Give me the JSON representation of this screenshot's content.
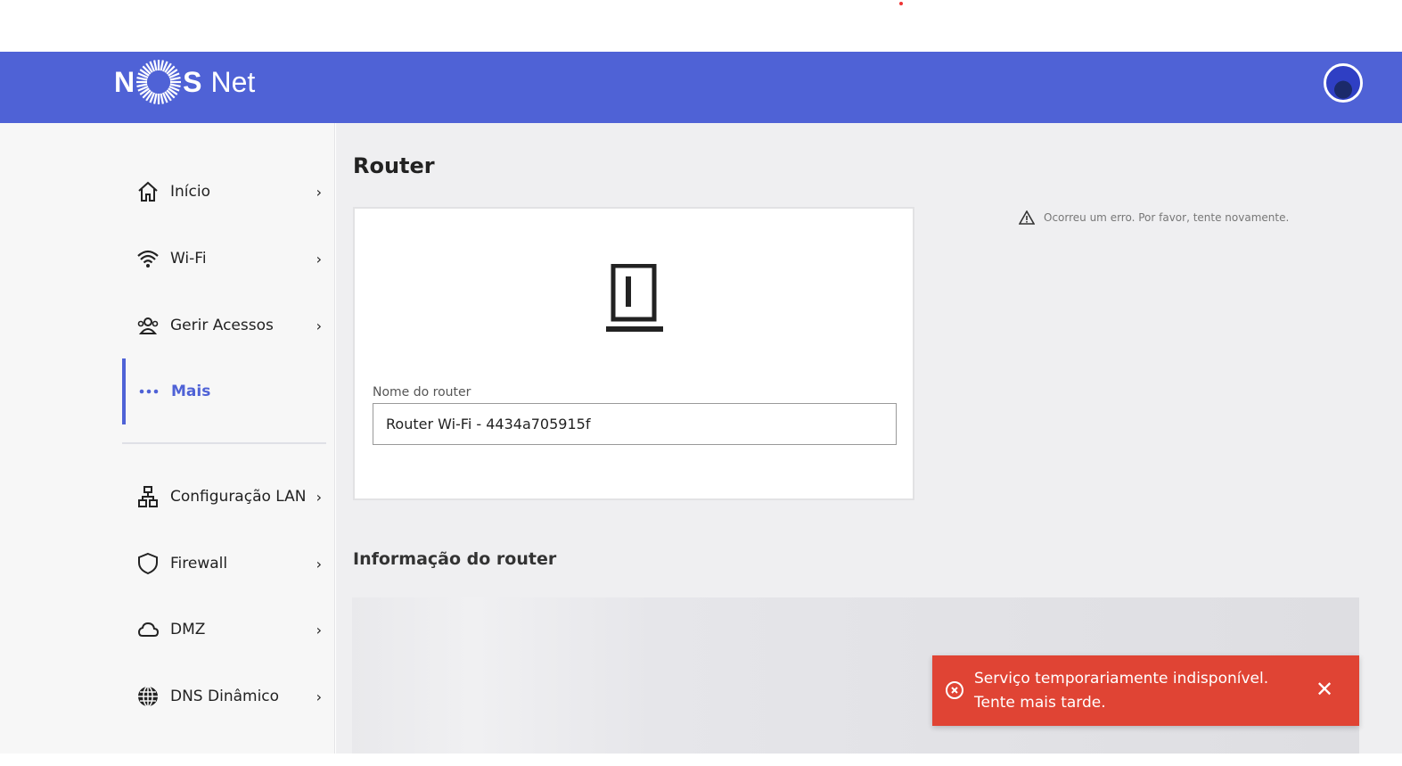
{
  "header": {
    "logo_text_left": "N",
    "logo_text_right": "S",
    "logo_suffix": "Net"
  },
  "sidebar": {
    "items": [
      {
        "label": "Início",
        "icon": "home-icon"
      },
      {
        "label": "Wi-Fi",
        "icon": "wifi-icon"
      },
      {
        "label": "Gerir Acessos",
        "icon": "users-icon"
      },
      {
        "label": "Mais",
        "icon": "more-dots-icon",
        "active": true
      },
      {
        "label": "Configuração LAN",
        "icon": "network-icon"
      },
      {
        "label": "Firewall",
        "icon": "shield-icon"
      },
      {
        "label": "DMZ",
        "icon": "cloud-icon"
      },
      {
        "label": "DNS Dinâmico",
        "icon": "globe-icon"
      }
    ],
    "chevron": "›"
  },
  "main": {
    "title": "Router",
    "router_name_label": "Nome do router",
    "router_name_value": "Router Wi-Fi - 4434a705915f",
    "error_text": "Ocorreu um erro. Por favor, tente novamente.",
    "info_title": "Informação do router"
  },
  "toast": {
    "message": "Serviço temporariamente indisponível. Tente mais tarde.",
    "close": "✕"
  },
  "colors": {
    "brand": "#4f62d6",
    "error": "#e04434"
  }
}
